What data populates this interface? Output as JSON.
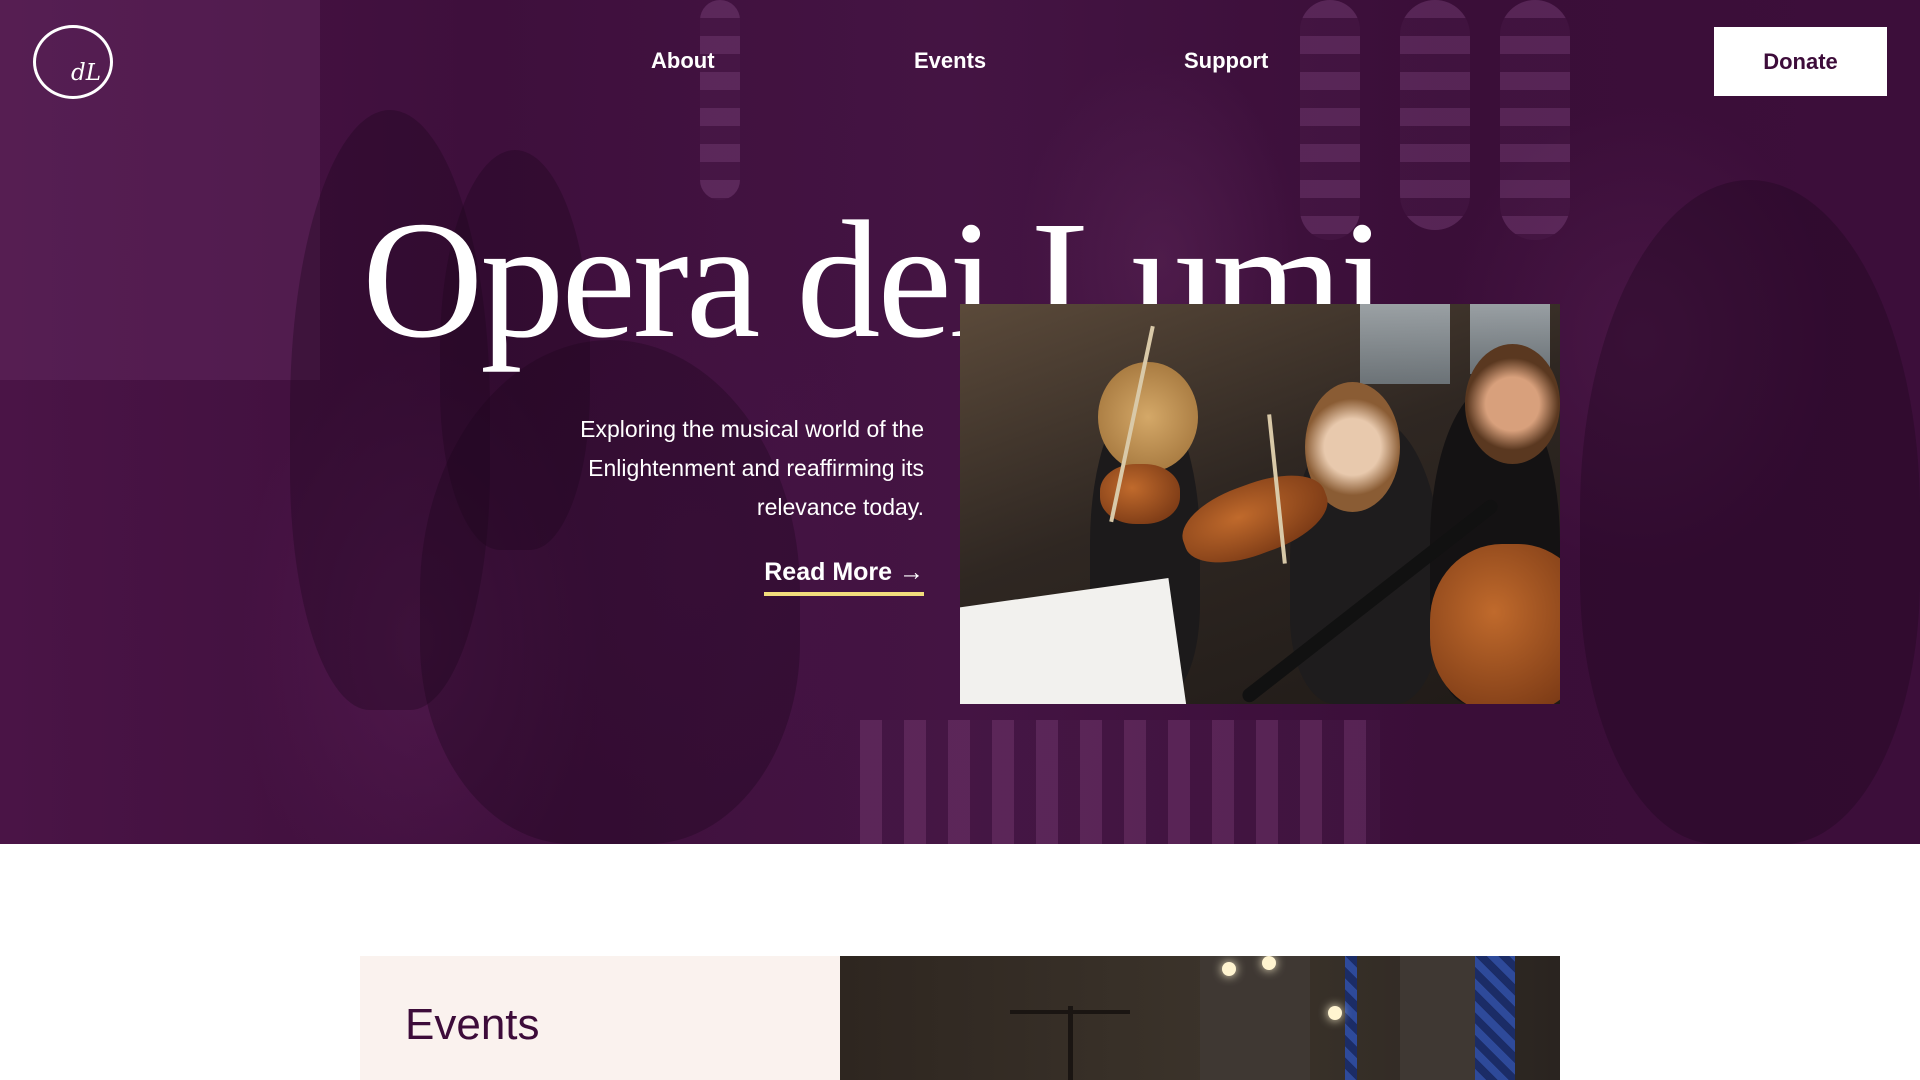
{
  "brand": {
    "logo_text": "dL"
  },
  "nav": {
    "items": [
      {
        "label": "About"
      },
      {
        "label": "Events"
      },
      {
        "label": "Support"
      }
    ],
    "donate_label": "Donate"
  },
  "hero": {
    "title": "Opera dei Lumi",
    "subtitle": "Exploring the musical world of the Enlightenment and reaffirming its relevance today.",
    "read_more_label": "Read More →"
  },
  "events": {
    "heading": "Events"
  },
  "colors": {
    "brand_purple": "#3d0c3a",
    "accent_yellow": "#f1dd7c",
    "card_background": "#faf2ee",
    "white": "#ffffff"
  }
}
